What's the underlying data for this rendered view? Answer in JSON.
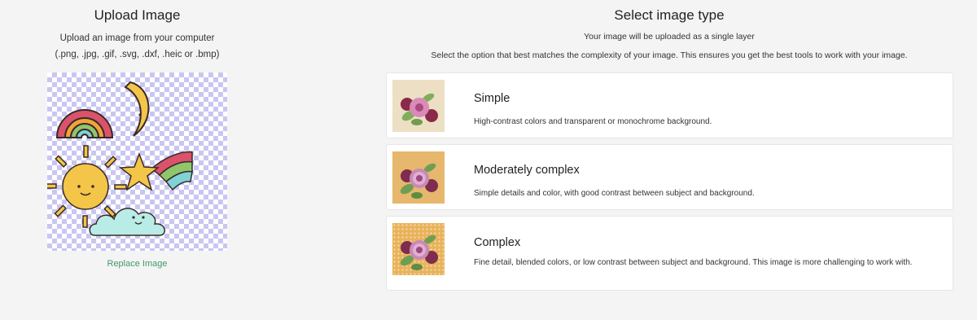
{
  "upload": {
    "title": "Upload Image",
    "instruction": "Upload an image from your computer",
    "formats": "(.png, .jpg, .gif, .svg, .dxf, .heic or .bmp)",
    "replace_label": "Replace Image"
  },
  "select": {
    "title": "Select image type",
    "subtitle": "Your image will be uploaded as a single layer",
    "helper": "Select the option that best matches the complexity of your image. This ensures you get the best tools to work with your image."
  },
  "options": [
    {
      "label": "Simple",
      "description": "High-contrast colors and transparent or monochrome background.",
      "thumb_bg": "#ecdfc3"
    },
    {
      "label": "Moderately complex",
      "description": "Simple details and color, with good contrast between subject and background.",
      "thumb_bg": "#e6b76c"
    },
    {
      "label": "Complex",
      "description": "Fine detail, blended colors, or low contrast between subject and background. This image is more challenging to work with.",
      "thumb_bg": "#e8b35a"
    }
  ],
  "colors": {
    "link_green": "#3d9a6c",
    "checker": "#c9c6f2",
    "page_bg": "#f4f4f4"
  }
}
